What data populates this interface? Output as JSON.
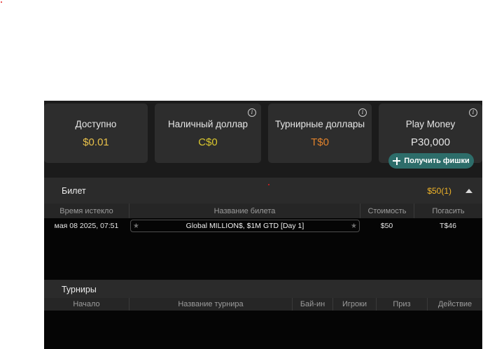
{
  "balances": [
    {
      "label": "Доступно",
      "value": "$0.01",
      "color": "#e8c04a",
      "info": false
    },
    {
      "label": "Наличный доллар",
      "value": "C$0",
      "color": "#d9c62e",
      "info": true
    },
    {
      "label": "Турнирные доллары",
      "value": "T$0",
      "color": "#e0822c",
      "info": true
    },
    {
      "label": "Play Money",
      "value": "P30,000",
      "color": "#e6e6e6",
      "info": true
    }
  ],
  "get_chips_label": "Получить фишки",
  "tickets": {
    "title": "Билет",
    "summary": "$50(1)",
    "columns": [
      "Время истекло",
      "Название билета",
      "Стоимость",
      "Погасить"
    ],
    "rows": [
      {
        "expires": "мая 08 2025, 07:51",
        "name": "Global MILLION$, $1M GTD [Day 1]",
        "cost": "$50",
        "redeem": "T$46"
      }
    ]
  },
  "tournaments": {
    "title": "Турниры",
    "columns": [
      "Начало",
      "Название турнира",
      "Бай-ин",
      "Игроки",
      "Приз",
      "Действие"
    ]
  },
  "icons": {
    "info": "info-icon",
    "star": "star-icon",
    "plus": "plus-icon",
    "collapse": "chevron-up-icon"
  }
}
